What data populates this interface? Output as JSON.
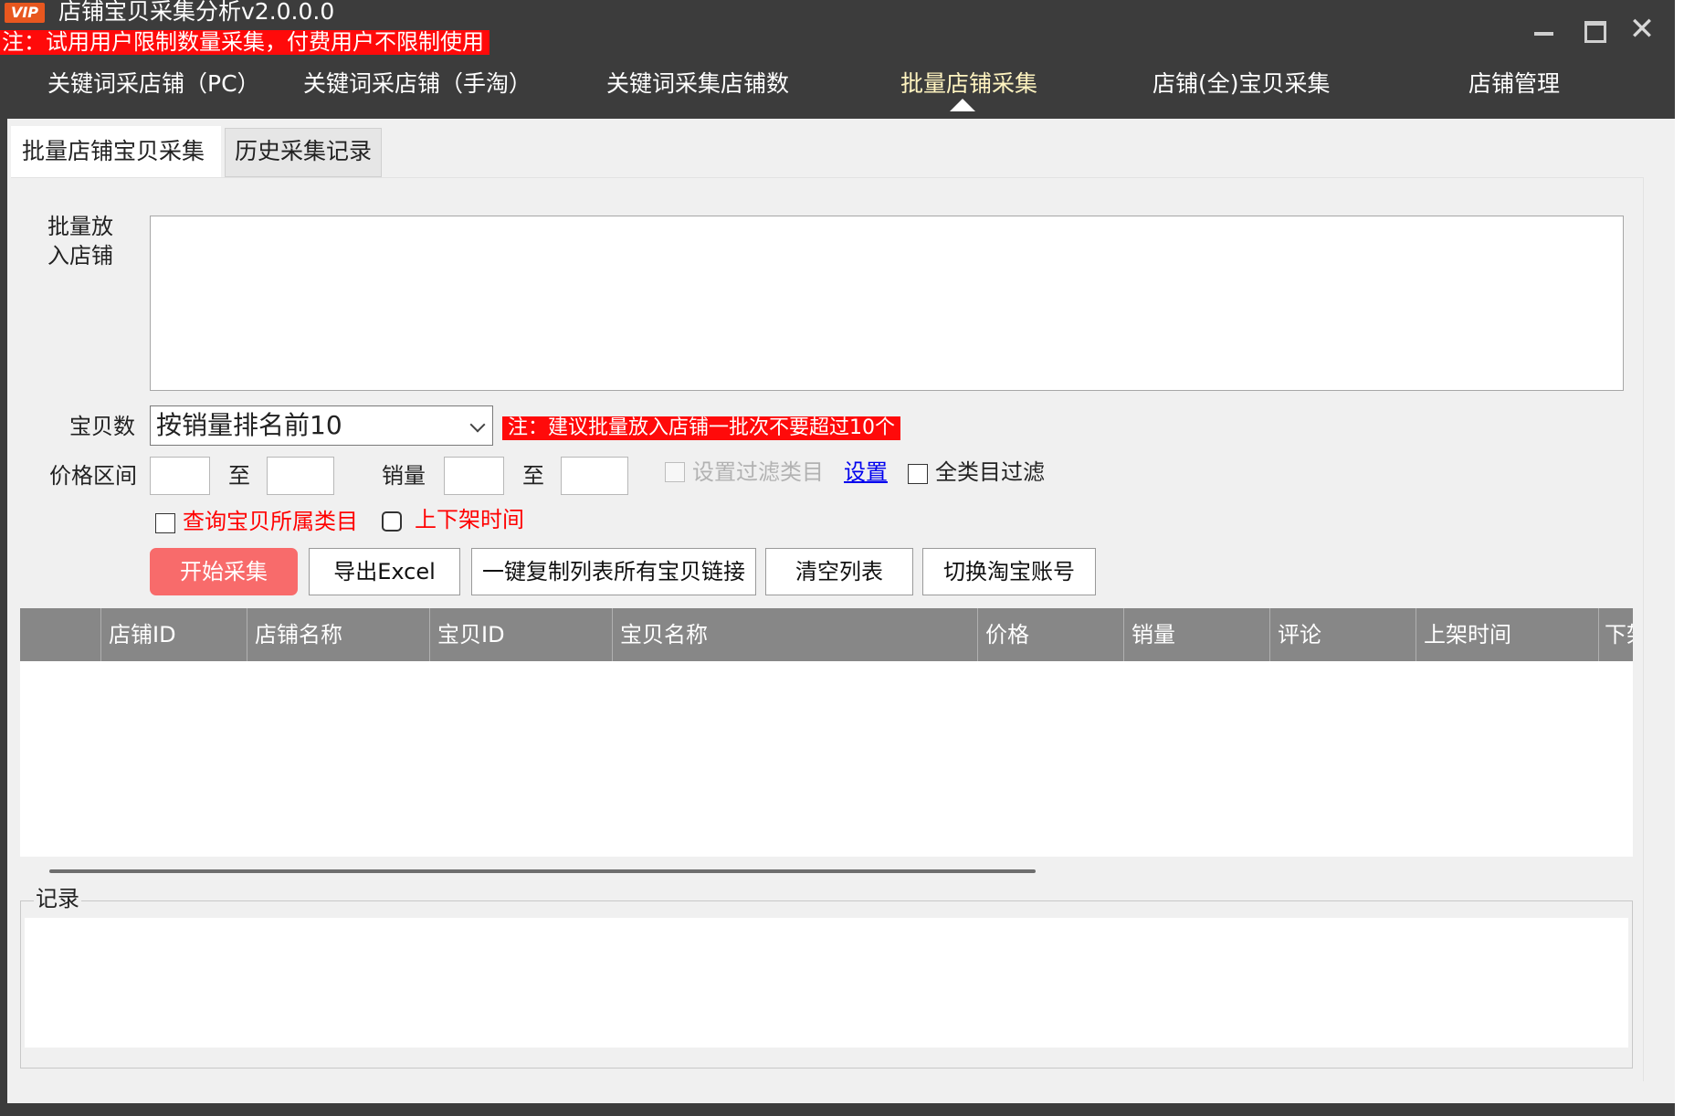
{
  "titlebar": {
    "logo_text": "VIP",
    "title": "店铺宝贝采集分析v2.0.0.0",
    "trial_note": "注：试用用户限制数量采集，付费用户不限制使用"
  },
  "nav": {
    "items": [
      {
        "label": "关键词采店铺（PC）"
      },
      {
        "label": "关键词采店铺（手淘）"
      },
      {
        "label": "关键词采集店铺数"
      },
      {
        "label": "批量店铺采集"
      },
      {
        "label": "店铺(全)宝贝采集"
      },
      {
        "label": "店铺管理"
      }
    ],
    "active_index": 3
  },
  "tabs": [
    {
      "label": "批量店铺宝贝采集"
    },
    {
      "label": "历史采集记录"
    }
  ],
  "form": {
    "shop_label": "批量放入店铺",
    "shop_text": "",
    "item_count_label": "宝贝数",
    "item_count_value": "按销量排名前10",
    "tip_note": "注：建议批量放入店铺一批次不要超过10个",
    "price_label": "价格区间",
    "to_label_1": "至",
    "sales_label": "销量",
    "to_label_2": "至",
    "price_min": "",
    "price_max": "",
    "sales_min": "",
    "sales_max": "",
    "filter_category_label": "设置过滤类目",
    "filter_category_checked": false,
    "set_link": "设置",
    "all_category_filter_label": "全类目过滤",
    "all_category_filter_checked": false,
    "query_category_label": "查询宝贝所属类目",
    "query_category_checked": false,
    "listing_time_label": "上下架时间",
    "listing_time_checked": false
  },
  "buttons": {
    "start": "开始采集",
    "export": "导出Excel",
    "copy_links": "一键复制列表所有宝贝链接",
    "clear": "清空列表",
    "switch_account": "切换淘宝账号"
  },
  "table": {
    "columns": [
      "",
      "店铺ID",
      "店铺名称",
      "宝贝ID",
      "宝贝名称",
      "价格",
      "销量",
      "评论",
      "上架时间",
      "下架"
    ],
    "rows": []
  },
  "log": {
    "legend": "记录",
    "content": ""
  },
  "colors": {
    "titlebar_bg": "#3c3c3c",
    "alert_red": "#ff0a0a",
    "primary_button": "#f86b6b",
    "table_header": "#878787",
    "active_nav": "#fff4c0"
  }
}
